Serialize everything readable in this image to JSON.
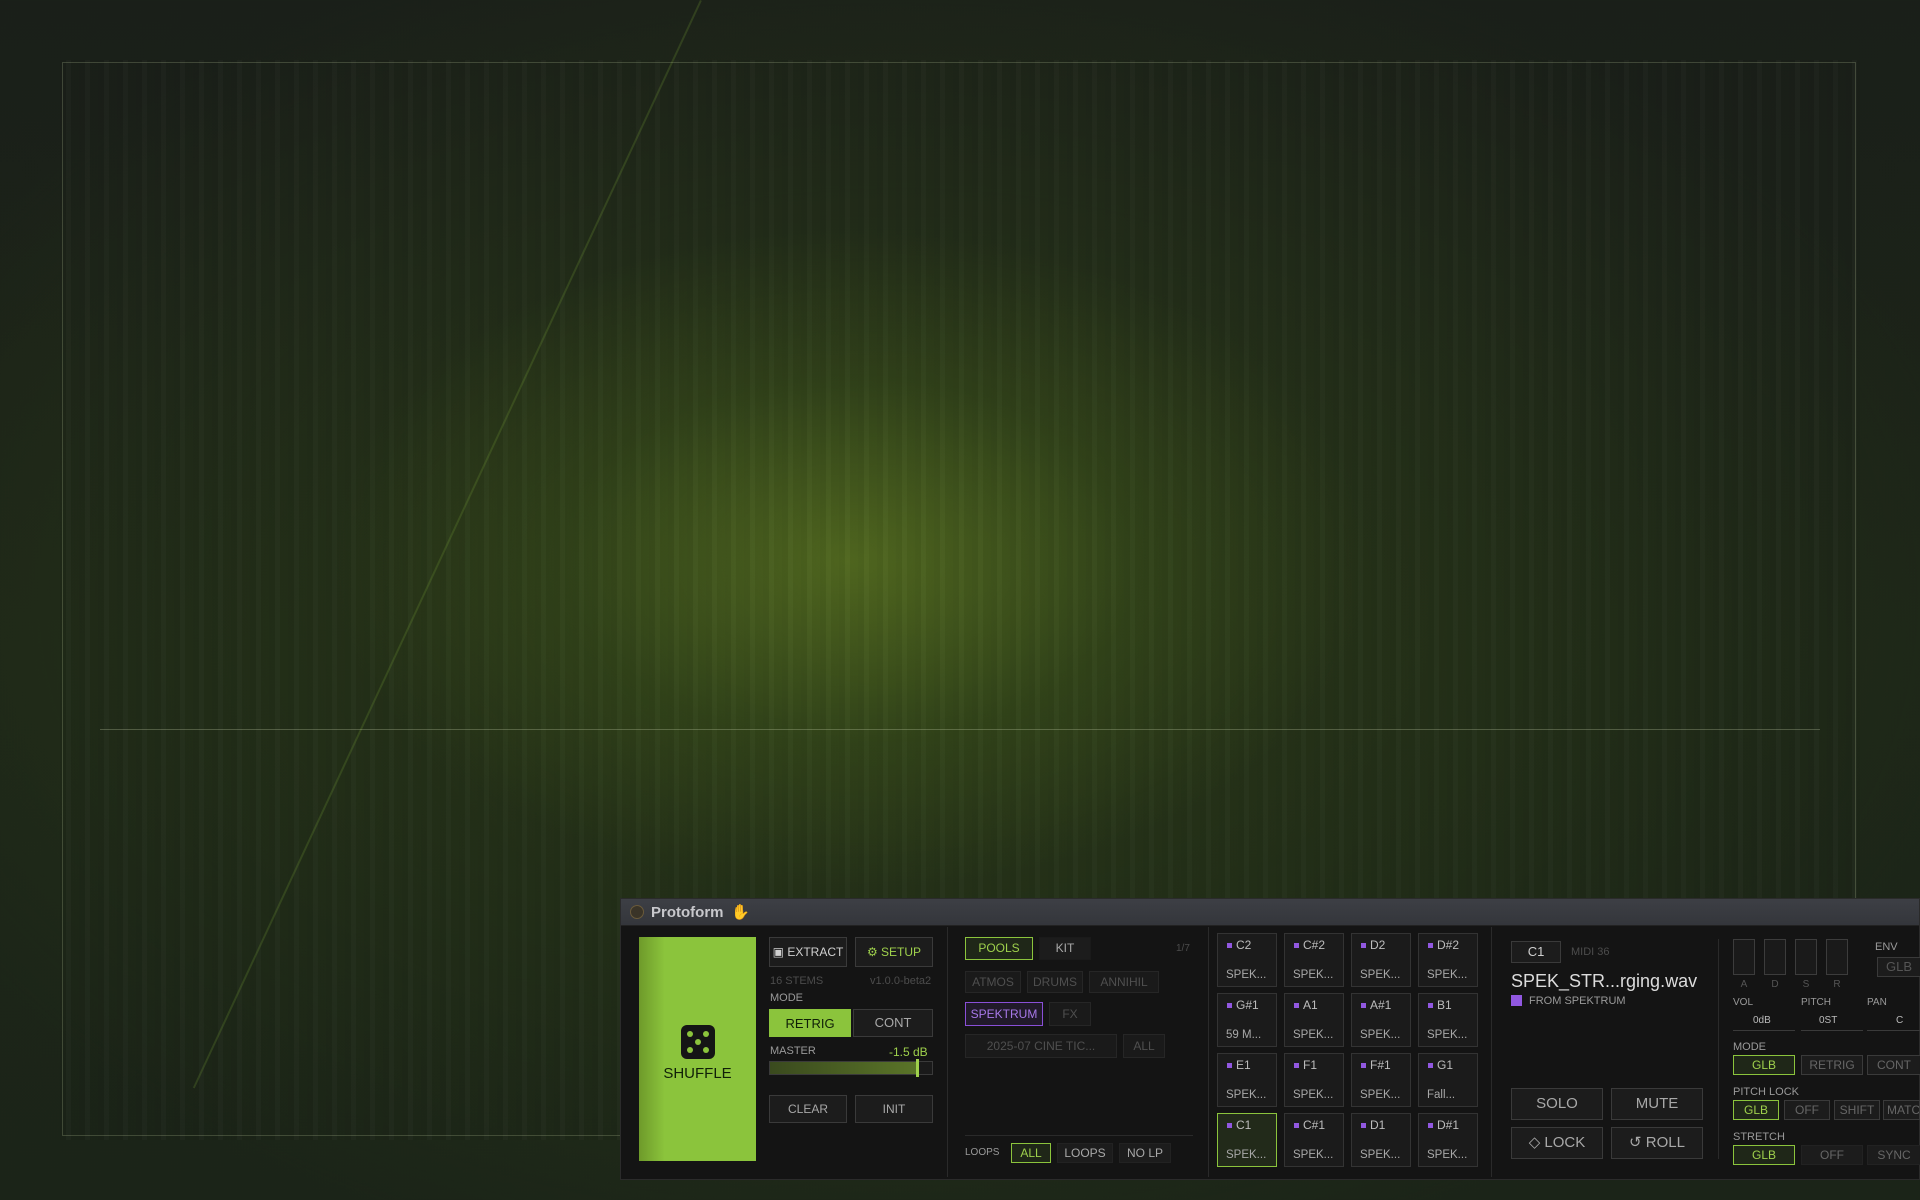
{
  "plugin": {
    "title": "Protoform",
    "hand_icon": "✋"
  },
  "left": {
    "shuffle_label": "SHUFFLE",
    "extract": "▣ EXTRACT",
    "setup": "⚙ SETUP",
    "stems": "16 STEMS",
    "version": "v1.0.0-beta2",
    "mode_label": "MODE",
    "mode_retrig": "RETRIG",
    "mode_cont": "CONT",
    "master_label": "MASTER",
    "master_value": "-1.5 dB",
    "master_level": 0.9,
    "clear": "CLEAR",
    "init": "INIT"
  },
  "browser": {
    "tab_pools": "POOLS",
    "tab_kit": "KIT",
    "page": "1/7",
    "chips": [
      "ATMOS",
      "DRUMS",
      "ANNIHIL",
      "SPEKTRUM",
      "FX"
    ],
    "folder": "2025-07 CINE TIC...",
    "all": "ALL",
    "loops_label": "LOOPS",
    "loops_all": "ALL",
    "loops_loops": "LOOPS",
    "loops_nolp": "NO LP"
  },
  "pads": [
    {
      "note": "C2",
      "sample": "SPEK..."
    },
    {
      "note": "C#2",
      "sample": "SPEK..."
    },
    {
      "note": "D2",
      "sample": "SPEK..."
    },
    {
      "note": "D#2",
      "sample": "SPEK..."
    },
    {
      "note": "G#1",
      "sample": "59 M..."
    },
    {
      "note": "A1",
      "sample": "SPEK..."
    },
    {
      "note": "A#1",
      "sample": "SPEK..."
    },
    {
      "note": "B1",
      "sample": "SPEK..."
    },
    {
      "note": "E1",
      "sample": "SPEK..."
    },
    {
      "note": "F1",
      "sample": "SPEK..."
    },
    {
      "note": "F#1",
      "sample": "SPEK..."
    },
    {
      "note": "G1",
      "sample": "Fall..."
    },
    {
      "note": "C1",
      "sample": "SPEK..."
    },
    {
      "note": "C#1",
      "sample": "SPEK..."
    },
    {
      "note": "D1",
      "sample": "SPEK..."
    },
    {
      "note": "D#1",
      "sample": "SPEK..."
    }
  ],
  "detail": {
    "note": "C1",
    "midi": "MIDI 36",
    "filename": "SPEK_STR...rging.wav",
    "source": "FROM SPEKTRUM",
    "solo": "SOLO",
    "mute": "MUTE",
    "lock": "◇ LOCK",
    "roll": "↺ ROLL"
  },
  "settings": {
    "adsr": [
      "A",
      "D",
      "S",
      "R"
    ],
    "env_label": "ENV",
    "env_value": "GLB",
    "vol_label": "VOL",
    "vol_value": "0dB",
    "pitch_label": "PITCH",
    "pitch_value": "0ST",
    "pan_label": "PAN",
    "pan_value": "C",
    "mode_label": "MODE",
    "mode_opts": [
      "GLB",
      "RETRIG",
      "CONT"
    ],
    "pitchlock_label": "PITCH LOCK",
    "pitchlock_opts": [
      "GLB",
      "OFF",
      "SHIFT",
      "MATCH"
    ],
    "stretch_label": "STRETCH",
    "stretch_opts": [
      "GLB",
      "OFF",
      "SYNC"
    ]
  },
  "colors": {
    "accent": "#8bc43c",
    "purple": "#9158e0",
    "panel": "#141414"
  }
}
